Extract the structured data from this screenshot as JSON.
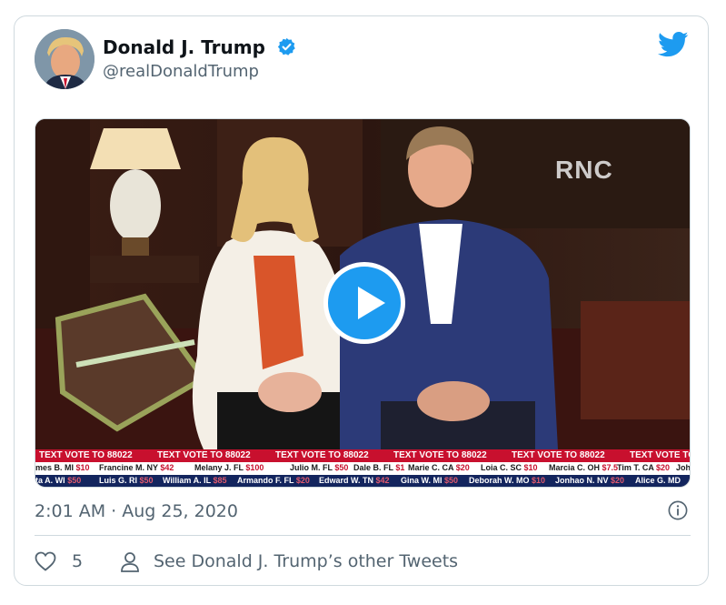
{
  "author": {
    "name": "Donald J. Trump",
    "handle": "@realDonaldTrump",
    "verified": true
  },
  "media": {
    "watermark": "RNC",
    "play_icon": "play-icon",
    "ticker_headline": "TEXT VOTE TO 88022",
    "ticker_row1": [
      {
        "name": "mes B. MI",
        "amount": "$10"
      },
      {
        "name": "Francine M. NY",
        "amount": "$42"
      },
      {
        "name": "Melany J. FL",
        "amount": "$100"
      },
      {
        "name": "Julio M. FL",
        "amount": "$50"
      },
      {
        "name": "Dale B. FL",
        "amount": "$1"
      },
      {
        "name": "Marie C. CA",
        "amount": "$20"
      },
      {
        "name": "Loia C. SC",
        "amount": "$10"
      },
      {
        "name": "Marcia C. OH",
        "amount": "$7.5"
      },
      {
        "name": "Tim T. CA",
        "amount": "$20"
      },
      {
        "name": "Joh",
        "amount": ""
      }
    ],
    "ticker_row2": [
      {
        "name": "ta A. WI",
        "amount": "$50"
      },
      {
        "name": "Luis G. RI",
        "amount": "$50"
      },
      {
        "name": "William A. IL",
        "amount": "$85"
      },
      {
        "name": "Armando F. FL",
        "amount": "$20"
      },
      {
        "name": "Edward W. TN",
        "amount": "$42"
      },
      {
        "name": "Gina W. MI",
        "amount": "$50"
      },
      {
        "name": "Deborah W. MO",
        "amount": "$10"
      },
      {
        "name": "Jonhao N. NV",
        "amount": "$20"
      },
      {
        "name": "Alice G. MD",
        "amount": ""
      }
    ]
  },
  "timestamp": "2:01 AM · Aug 25, 2020",
  "footer": {
    "likes": "5",
    "see_more": "See Donald J. Trump’s other Tweets"
  },
  "colors": {
    "accent": "#1d9bf0",
    "muted_text": "#536471",
    "ticker_red": "#c8102e",
    "ticker_navy": "#13255e"
  }
}
